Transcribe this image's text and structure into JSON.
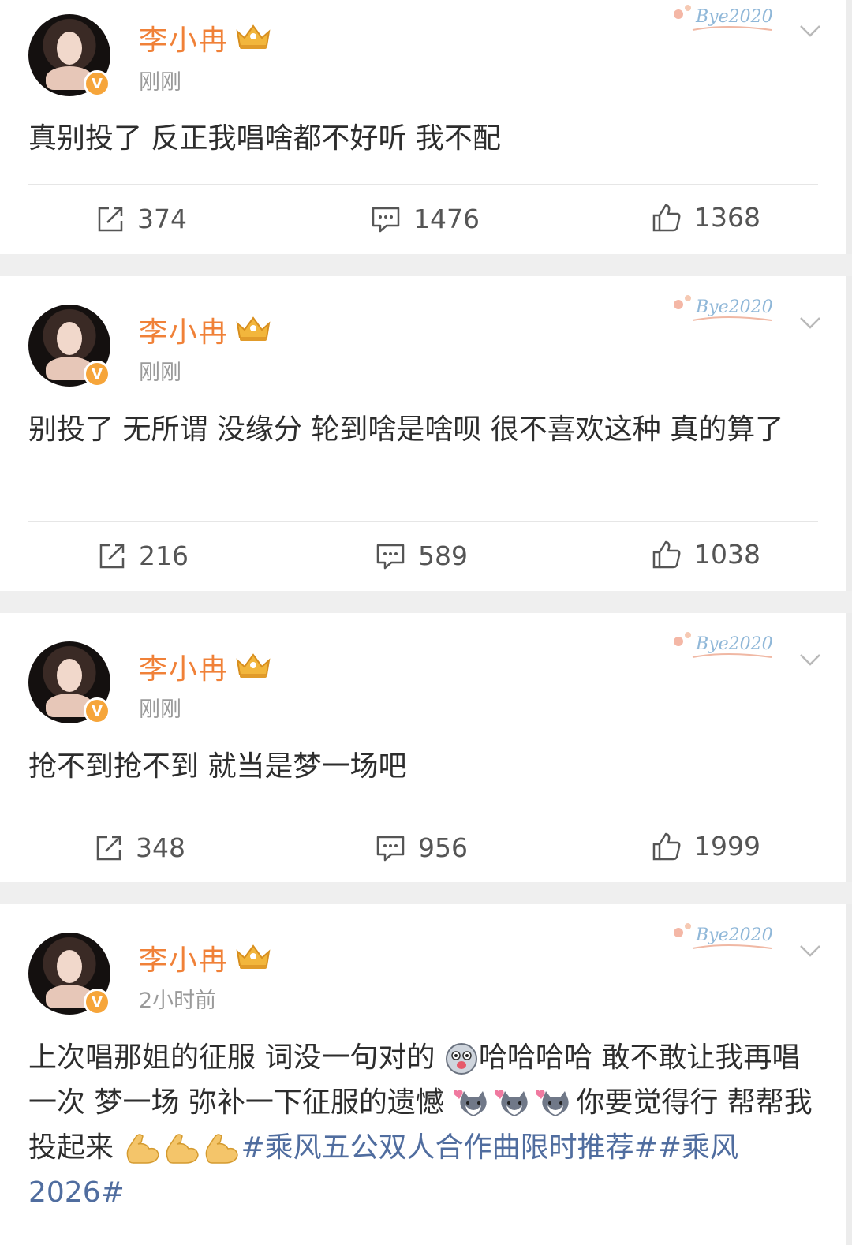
{
  "posts": [
    {
      "author": "李小冉",
      "time": "刚刚",
      "sticker_text": "Bye2020",
      "text": "真别投了 反正我唱啥都不好听 我不配",
      "repost": "374",
      "comment": "1476",
      "like": "1368"
    },
    {
      "author": "李小冉",
      "time": "刚刚",
      "sticker_text": "Bye2020",
      "text": "别投了 无所谓 没缘分 轮到啥是啥呗 很不喜欢这种 真的算了",
      "repost": "216",
      "comment": "589",
      "like": "1038"
    },
    {
      "author": "李小冉",
      "time": "刚刚",
      "sticker_text": "Bye2020",
      "text": "抢不到抢不到 就当是梦一场吧",
      "repost": "348",
      "comment": "956",
      "like": "1999"
    },
    {
      "author": "李小冉",
      "time": "2小时前",
      "sticker_text": "Bye2020",
      "text_a": "上次唱那姐的征服 词没一句对的",
      "text_b": "哈哈哈哈 敢不敢让我再唱一次 梦一场 弥补一下征服的遗憾",
      "text_c": "你要觉得行 帮帮我 投起来",
      "tag1": "#乘风五公双人合作曲限时推荐#",
      "tag2": "#乘风 2026#"
    }
  ],
  "icons": {
    "repost": "repost-icon",
    "comment": "comment-icon",
    "like": "thumbs-up-icon",
    "verified": "verified-v-badge",
    "crown": "crown-membership-icon",
    "chevron": "chevron-down-icon"
  },
  "colors": {
    "author": "#f08138",
    "hashtag": "#506d9f",
    "badge": "#f6a53a",
    "meta": "#9a9a9a"
  }
}
